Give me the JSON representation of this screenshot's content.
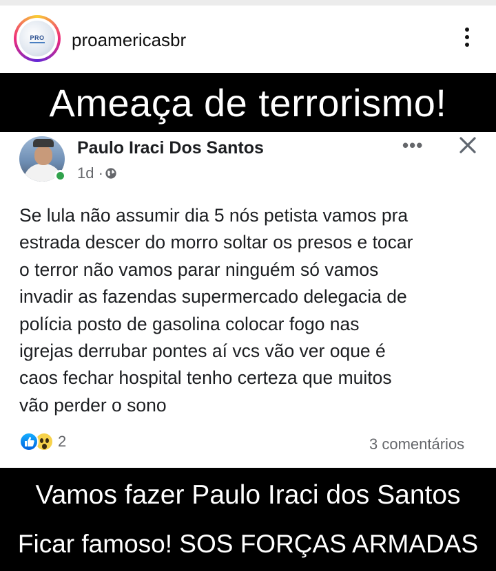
{
  "instagram": {
    "username": "proamericasbr",
    "avatar_logo_text": "PRO",
    "more_icon": "more-vertical-icon"
  },
  "headline": "Ameaça de terrorismo!",
  "fb_post": {
    "author": "Paulo Iraci Dos Santos",
    "time": "1d ·",
    "privacy_icon": "globe-icon",
    "more_label": "•••",
    "close_icon": "close-icon",
    "body_lines": [
      "Se lula não assumir dia 5 nós petista vamos pra",
      "estrada descer do morro soltar os presos e tocar",
      "o terror não vamos parar ninguém só vamos",
      "invadir as fazendas supermercado delegacia de",
      "polícia posto de gasolina colocar fogo nas",
      "igrejas derrubar pontes aí vcs vão ver oque é",
      "caos fechar hospital tenho certeza que muitos",
      "vão perder o sono"
    ],
    "reactions": [
      "like",
      "wow"
    ],
    "reaction_count": "2",
    "comments": "3 comentários",
    "colors": {
      "online": "#31a24c",
      "like": "#0062df",
      "wow": "#f7d24b"
    }
  },
  "footer": {
    "line1": "Vamos fazer Paulo Iraci dos Santos",
    "line2": "Ficar famoso! SOS FORÇAS ARMADAS"
  }
}
